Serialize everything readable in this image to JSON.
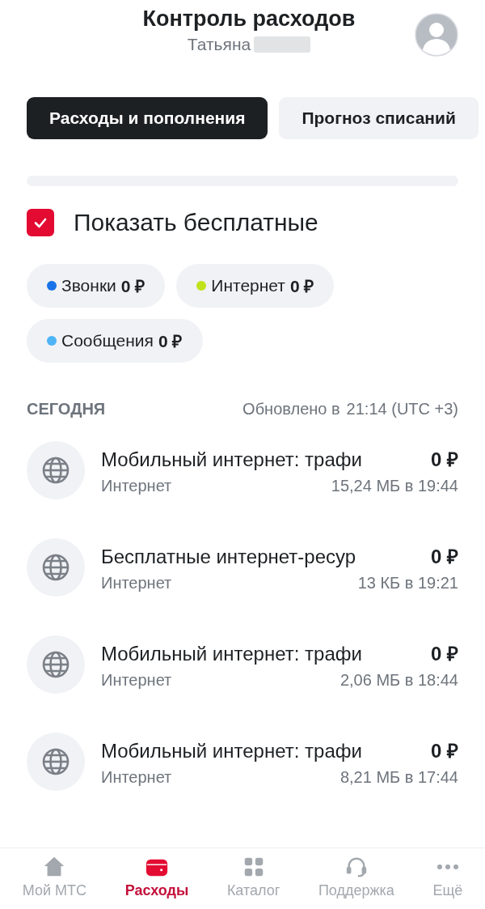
{
  "header": {
    "title": "Контроль расходов",
    "subtitle": "Татьяна"
  },
  "tabs": [
    {
      "label": "Расходы и пополнения",
      "selected": true
    },
    {
      "label": "Прогноз списаний",
      "selected": false
    }
  ],
  "show_free": {
    "label": "Показать бесплатные",
    "checked": true
  },
  "chips": [
    {
      "label": "Звонки",
      "amount": "0 ₽",
      "color": "#1a73e8"
    },
    {
      "label": "Интернет",
      "amount": "0 ₽",
      "color": "#bfe31a"
    },
    {
      "label": "Сообщения",
      "amount": "0 ₽",
      "color": "#4fb4f5"
    }
  ],
  "section": {
    "title": "СЕГОДНЯ",
    "updated_label": "Обновлено в",
    "updated_time": "21:14 (UTC +3)"
  },
  "transactions": [
    {
      "title": "Мобильный интернет: трафи",
      "amount": "0 ₽",
      "category": "Интернет",
      "detail": "15,24 МБ в 19:44"
    },
    {
      "title": "Бесплатные интернет-ресур",
      "amount": "0 ₽",
      "category": "Интернет",
      "detail": "13 КБ в 19:21"
    },
    {
      "title": "Мобильный интернет: трафи",
      "amount": "0 ₽",
      "category": "Интернет",
      "detail": "2,06 МБ в 18:44"
    },
    {
      "title": "Мобильный интернет: трафи",
      "amount": "0 ₽",
      "category": "Интернет",
      "detail": "8,21 МБ в 17:44"
    }
  ],
  "nav": [
    {
      "label": "Мой МТС",
      "kind": "home",
      "selected": false
    },
    {
      "label": "Расходы",
      "kind": "wallet",
      "selected": true
    },
    {
      "label": "Каталог",
      "kind": "grid",
      "selected": false
    },
    {
      "label": "Поддержка",
      "kind": "headset",
      "selected": false
    },
    {
      "label": "Ещё",
      "kind": "more",
      "selected": false
    }
  ]
}
